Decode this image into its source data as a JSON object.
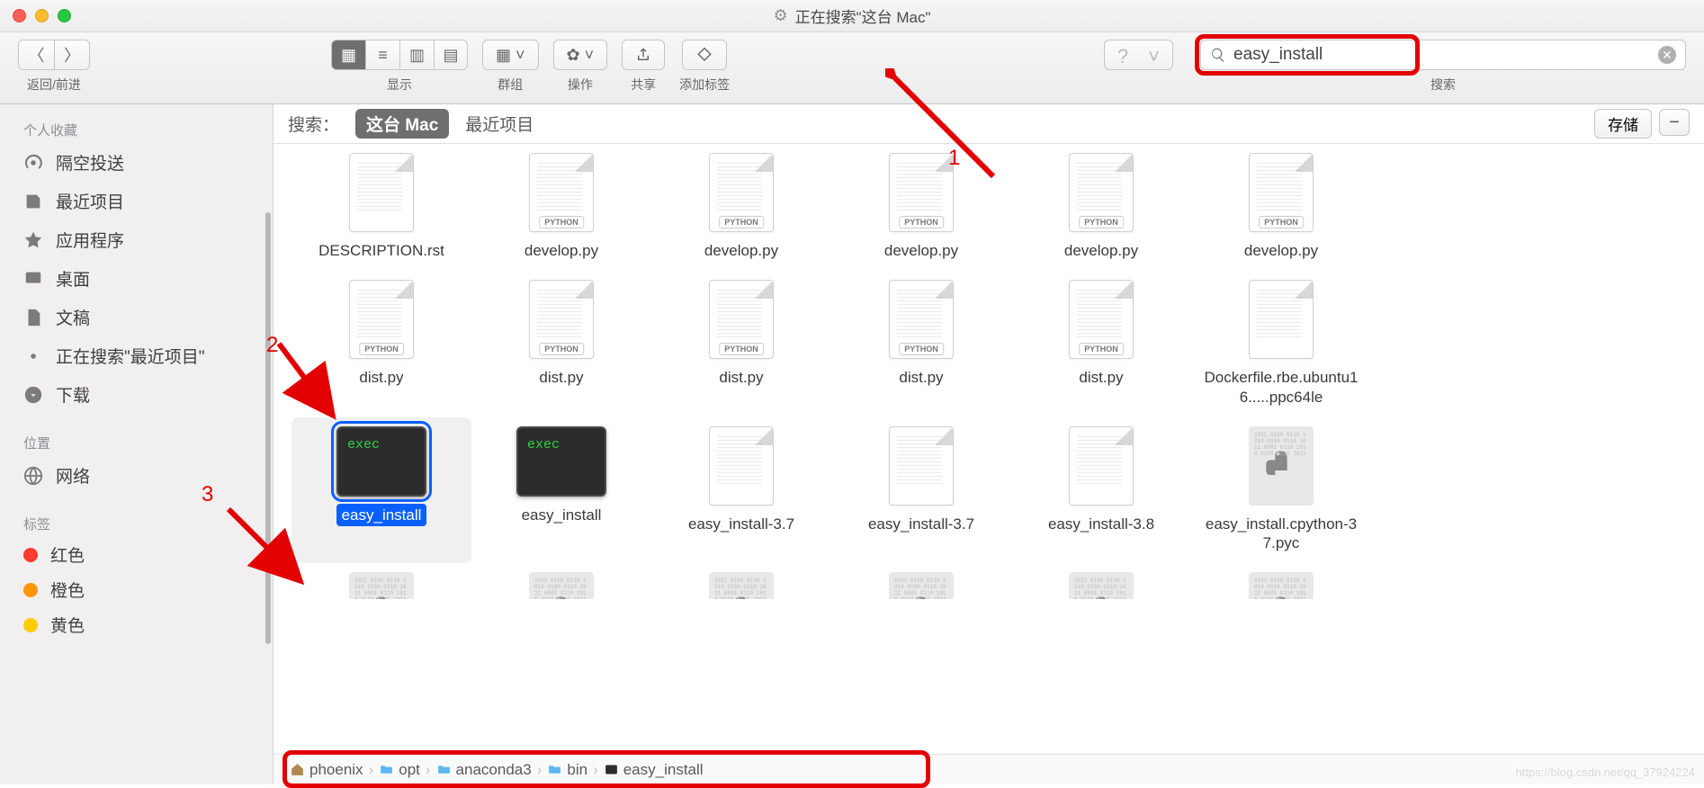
{
  "window_title": "正在搜索\"这台 Mac\"",
  "toolbar": {
    "nav_label": "返回/前进",
    "view_label": "显示",
    "group_label": "群组",
    "action_label": "操作",
    "share_label": "共享",
    "tag_label": "添加标签",
    "search_label": "搜索",
    "search_value": "easy_install"
  },
  "scope": {
    "label": "搜索：",
    "current_active": "这台 Mac",
    "recent": "最近项目",
    "save": "存储"
  },
  "sidebar": {
    "favorites_header": "个人收藏",
    "favorites": [
      {
        "icon": "airdrop",
        "label": "隔空投送"
      },
      {
        "icon": "recent",
        "label": "最近项目"
      },
      {
        "icon": "apps",
        "label": "应用程序"
      },
      {
        "icon": "desktop",
        "label": "桌面"
      },
      {
        "icon": "docs",
        "label": "文稿"
      },
      {
        "icon": "search",
        "label": "正在搜索\"最近项目\""
      },
      {
        "icon": "download",
        "label": "下载"
      }
    ],
    "locations_header": "位置",
    "locations": [
      {
        "icon": "network",
        "label": "网络"
      }
    ],
    "tags_header": "标签",
    "tags": [
      {
        "color": "#ff3b30",
        "label": "红色"
      },
      {
        "color": "#ff9500",
        "label": "橙色"
      },
      {
        "color": "#ffcc00",
        "label": "黄色"
      }
    ]
  },
  "files": {
    "row1": [
      {
        "type": "doc",
        "badge": "",
        "name": "DESCRIPTION.rst"
      },
      {
        "type": "doc",
        "badge": "PYTHON",
        "name": "develop.py"
      },
      {
        "type": "doc",
        "badge": "PYTHON",
        "name": "develop.py"
      },
      {
        "type": "doc",
        "badge": "PYTHON",
        "name": "develop.py"
      },
      {
        "type": "doc",
        "badge": "PYTHON",
        "name": "develop.py"
      },
      {
        "type": "doc",
        "badge": "PYTHON",
        "name": "develop.py"
      }
    ],
    "row2": [
      {
        "type": "doc",
        "badge": "PYTHON",
        "name": "dist.py"
      },
      {
        "type": "doc",
        "badge": "PYTHON",
        "name": "dist.py"
      },
      {
        "type": "doc",
        "badge": "PYTHON",
        "name": "dist.py"
      },
      {
        "type": "doc",
        "badge": "PYTHON",
        "name": "dist.py"
      },
      {
        "type": "doc",
        "badge": "PYTHON",
        "name": "dist.py"
      },
      {
        "type": "doc",
        "badge": "",
        "name": "Dockerfile.rbe.ubuntu16.....ppc64le"
      }
    ],
    "row3": [
      {
        "type": "exec",
        "name": "easy_install",
        "selected": true
      },
      {
        "type": "exec",
        "name": "easy_install"
      },
      {
        "type": "doc",
        "badge": "",
        "name": "easy_install-3.7"
      },
      {
        "type": "doc",
        "badge": "",
        "name": "easy_install-3.7"
      },
      {
        "type": "doc",
        "badge": "",
        "name": "easy_install-3.8"
      },
      {
        "type": "pyc",
        "name": "easy_install.cpython-37.pyc"
      }
    ],
    "row4": [
      {
        "type": "pyc",
        "name": ""
      },
      {
        "type": "pyc",
        "name": ""
      },
      {
        "type": "pyc",
        "name": ""
      },
      {
        "type": "pyc",
        "name": ""
      },
      {
        "type": "pyc",
        "name": ""
      },
      {
        "type": "pyc",
        "name": ""
      }
    ]
  },
  "path": [
    {
      "icon": "home",
      "label": "phoenix"
    },
    {
      "icon": "folder",
      "label": "opt"
    },
    {
      "icon": "folder",
      "label": "anaconda3"
    },
    {
      "icon": "folder",
      "label": "bin"
    },
    {
      "icon": "exec",
      "label": "easy_install"
    }
  ],
  "annotations": {
    "n1": "1",
    "n2": "2",
    "n3": "3"
  }
}
